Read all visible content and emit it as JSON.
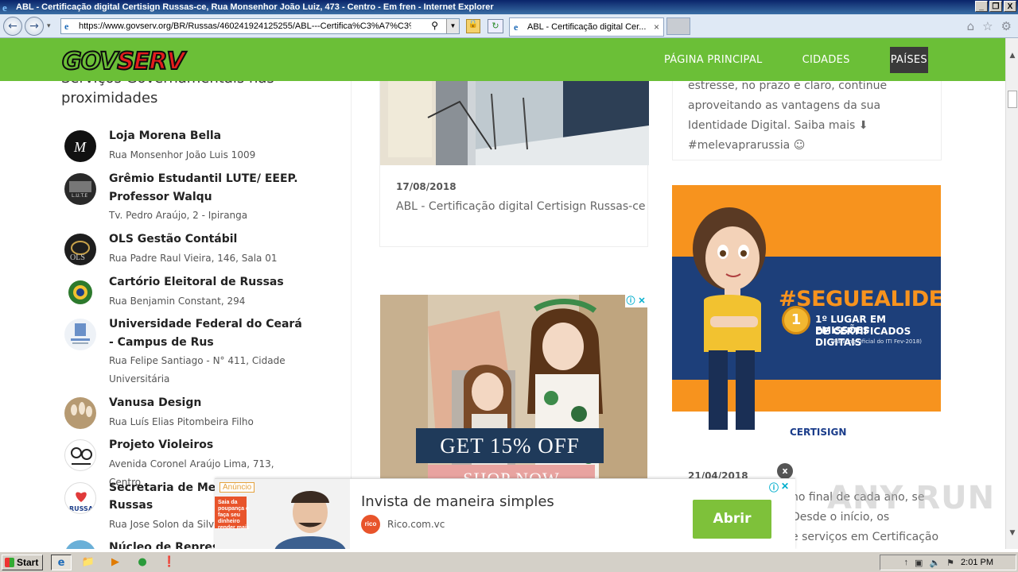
{
  "window": {
    "title": "ABL - Certificação digital Certisign Russas-ce, Rua Monsenhor João Luiz, 473 - Centro - Em fren - Internet Explorer",
    "controls": [
      "_",
      "❐",
      "X"
    ]
  },
  "browser": {
    "url": "https://www.govserv.org/BR/Russas/460241924125255/ABL---Certifica%C3%A7%C3%A3o",
    "tab_title": "ABL - Certificação digital Cer...",
    "tab_close": "×"
  },
  "site": {
    "logo_part1": "GOV",
    "logo_part2": "SERV",
    "menu": [
      {
        "label": "PÁGINA PRINCIPAL"
      },
      {
        "label": "CIDADES"
      },
      {
        "label": "PAÍSES"
      }
    ],
    "sidebar": {
      "title": "Serviços Governamentais nas proximidades",
      "items": [
        {
          "name": "Loja Morena Bella",
          "address": "Rua Monsenhor João Luis 1009"
        },
        {
          "name": "Grêmio Estudantil LUTE/ EEEP. Professor Walqu",
          "address": "Tv. Pedro Araújo, 2 - Ipiranga"
        },
        {
          "name": "OLS Gestão Contábil",
          "address": "Rua Padre Raul Vieira, 146, Sala 01"
        },
        {
          "name": "Cartório Eleitoral de Russas",
          "address": "Rua Benjamin Constant, 294"
        },
        {
          "name": "Universidade Federal do Ceará - Campus de Rus",
          "address": "Rua Felipe Santiago - N° 411, Cidade Universitária"
        },
        {
          "name": "Vanusa Design",
          "address": "Rua Luís Elias Pitombeira Filho"
        },
        {
          "name": "Projeto Violeiros",
          "address": "Avenida Coronel Araújo Lima, 713, Centro"
        },
        {
          "name": "Secretaria de Meio",
          "name2": "Russas",
          "address": "Rua Jose Solon da Silva"
        },
        {
          "name": "Núcleo de Represe"
        }
      ]
    },
    "post": {
      "date": "17/08/2018",
      "title": "ABL - Certificação digital Certisign Russas-ce"
    },
    "right_text": "estresse, no prazo e claro, continue aproveitando as vantagens da sua Identidade Digital. Saiba mais ⬇ #melevaprarussia ☺",
    "ad_kids": {
      "offer": "GET 15% OFF",
      "shop": "SHOP NOW"
    },
    "ad_cert": {
      "hashtag": "#SEGUEALIDER",
      "line1": "1º LUGAR EM EMISSÕES",
      "line2": "DE CERTIFICADOS DIGITAIS",
      "line3": "(Ranking Oficial do ITI Fev-2018)",
      "medal": "1",
      "brand": "CERTISIGN"
    },
    "post2": {
      "date": "21/04/2018",
      "text_lines": [
        "no final de cada ano, se",
        "Desde o início, os",
        "e serviços em Certificação"
      ]
    },
    "bottom_ad": {
      "badge": "Anúncio",
      "headline": "Invista de maneira simples",
      "domain": "Rico.com.vc",
      "logo_text": "rico",
      "cta": "Abrir",
      "photo_text": "Saia da poupança e faça seu dinheiro render mais"
    },
    "close_label": "x"
  },
  "taskbar": {
    "start": "Start",
    "clock": "2:01 PM"
  },
  "watermark": "ANY RUN"
}
